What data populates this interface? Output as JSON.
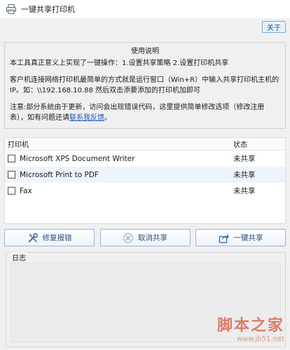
{
  "window": {
    "title": "一键共享打印机"
  },
  "toolbar": {
    "about_label": "关于"
  },
  "instructions": {
    "heading": "使用说明",
    "line1": "本工具真正意义上实现了一键操作：1.设置共享策略 2.设置打印机共享",
    "line2": "客户机连接网络打印机最简单的方式就是运行窗口（Win+R）中输入共享打印机主机的IP。如：\\\\192.168.10.88 然后双击添要添加的打印机加即可",
    "line3_before": "注意:部分系统由于更新，访问会出现错误代码，这里提供简单修改选项（修改注册表），如有问题还请",
    "line3_link": "联系我反馈",
    "line3_after": "。"
  },
  "printers": {
    "columns": {
      "name": "打印机",
      "status": "状态"
    },
    "items": [
      {
        "name": "Microsoft XPS Document Writer",
        "status": "未共享"
      },
      {
        "name": "Microsoft Print to PDF",
        "status": "未共享"
      },
      {
        "name": "Fax",
        "status": "未共享"
      }
    ]
  },
  "actions": {
    "repair_label": "修复报错",
    "unshare_label": "取消共享",
    "share_label": "一键共享"
  },
  "log": {
    "label": "日志"
  },
  "watermark": {
    "text": "脚本之家",
    "url": "www.jb51.net"
  }
}
